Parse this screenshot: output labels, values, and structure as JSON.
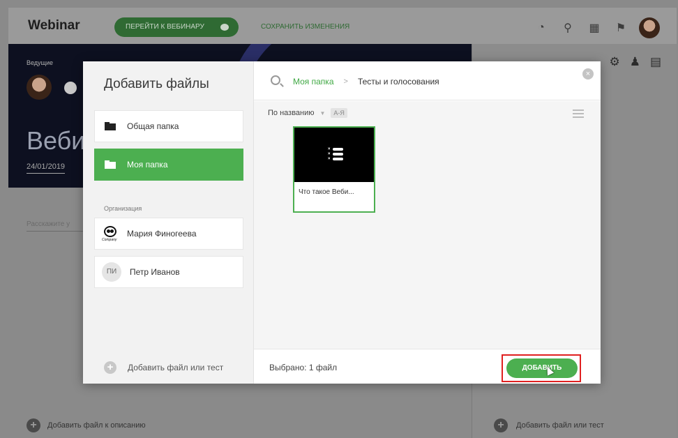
{
  "app": {
    "brand": "Webinar",
    "goto_button": "ПЕРЕЙТИ К ВЕБИНАРУ",
    "save_link": "СОХРАНИТЬ ИЗМЕНЕНИЯ",
    "icons": [
      "speedometer-icon",
      "search-icon",
      "grid-icon",
      "flag-icon",
      "user-avatar"
    ]
  },
  "banner": {
    "host_label": "Ведущие",
    "title": "Веби",
    "date": "24/01/2019"
  },
  "describe_placeholder": "Расскажите у",
  "bottom_left_add": "Добавить файл к описанию",
  "bottom_right_add": "Добавить файл или тест",
  "modal": {
    "title": "Добавить файлы",
    "folders": [
      {
        "label": "Общая папка",
        "active": false
      },
      {
        "label": "Моя папка",
        "active": true
      }
    ],
    "org_label": "Организация",
    "people": [
      {
        "label": "Мария Финогеева",
        "avatar": "panda",
        "avatar_text": "Company"
      },
      {
        "label": "Петр Иванов",
        "avatar": "initials",
        "initials": "ПИ"
      }
    ],
    "add_file_or_test": "Добавить файл или тест",
    "breadcrumb": {
      "root": "Моя папка",
      "separator": ">",
      "current": "Тесты и голосования"
    },
    "sort": {
      "label": "По названию",
      "order": "А-Я"
    },
    "files": [
      {
        "name": "Что такое Веби...",
        "type": "quiz",
        "selected": true
      }
    ],
    "selected_text": "Выбрано: 1 файл",
    "add_button": "ДОБАВИТЬ",
    "close_symbol": "×"
  },
  "colors": {
    "accent": "#4caf50",
    "highlight": "#e02020",
    "link": "#3fa843"
  }
}
